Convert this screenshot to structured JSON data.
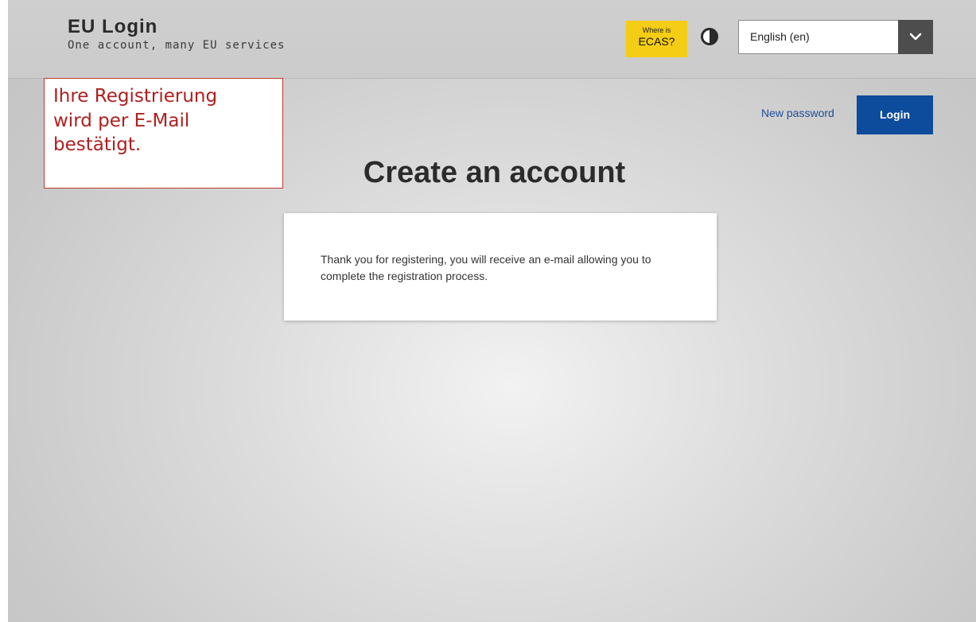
{
  "header": {
    "title": "EU Login",
    "subtitle": "One account, many EU services",
    "ecas_badge": {
      "small": "Where is",
      "big": "ECAS?"
    },
    "contrast_toggle_icon": "contrast-icon",
    "language": {
      "selected": "English (en)",
      "dropdown_icon": "chevron-down-icon"
    }
  },
  "annotation": {
    "text": "Ihre Registrierung\nwird per E-Mail\nbestätigt.",
    "border_color": "#c0392b",
    "text_color": "#b01e1e"
  },
  "actions": {
    "new_password": "New password",
    "login": "Login"
  },
  "main": {
    "title": "Create an account",
    "message": "Thank you for registering, you will receive an e-mail allowing you to complete the registration process."
  },
  "colors": {
    "accent_blue": "#0d4b9c",
    "ecas_yellow": "#f5cd14",
    "link_blue": "#1f4d9a"
  }
}
